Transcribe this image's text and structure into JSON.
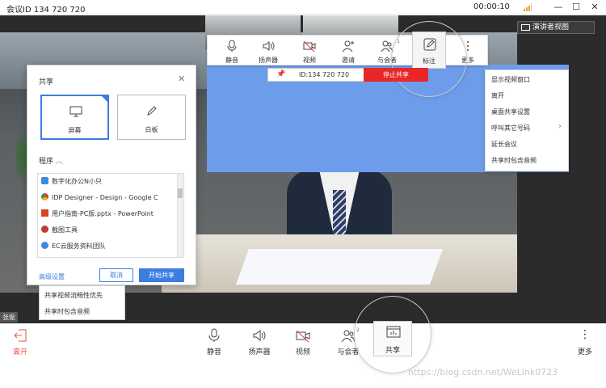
{
  "titlebar": {
    "title": "会议ID 134 720 720",
    "timer": "00:00:10",
    "min_icon": "—",
    "max_icon": "☐",
    "close_icon": "✕"
  },
  "presenter": {
    "speaker_view_label": "演讲者视图"
  },
  "top_toolbar": {
    "items": [
      {
        "label": "静音",
        "icon": "microphone-icon"
      },
      {
        "label": "扬声器",
        "icon": "speaker-icon"
      },
      {
        "label": "视频",
        "icon": "video-off-icon"
      },
      {
        "label": "邀请",
        "icon": "add-user-icon"
      },
      {
        "label": "与会者",
        "icon": "participants-icon",
        "badge": "1"
      },
      {
        "label": "标注",
        "icon": "pencil-icon"
      },
      {
        "label": "更多",
        "icon": "more-icon"
      }
    ]
  },
  "meeting_bar": {
    "id_text": "ID:134 720 720",
    "stop_label": "停止共享"
  },
  "more_menu": {
    "items": [
      {
        "label": "显示视频窗口"
      },
      {
        "label": "离开"
      },
      {
        "label": "桌面共享设置"
      },
      {
        "label": "呼叫其它号码",
        "arrow": "›"
      },
      {
        "label": "延长会议"
      },
      {
        "label": "共享时包含音频"
      }
    ]
  },
  "share_dialog": {
    "title": "共享",
    "close": "✕",
    "options": [
      {
        "label": "屏幕"
      },
      {
        "label": "白板"
      }
    ],
    "programs_header": "程序",
    "programs_caret": "︿",
    "programs": [
      {
        "label": "数字化办公N小只",
        "color": "#3a8be0"
      },
      {
        "label": "IDP Designer - Design - Google C",
        "color": "#e0b52a"
      },
      {
        "label": "用户指南-PC版.pptx - PowerPoint",
        "color": "#d24726"
      },
      {
        "label": "截图工具",
        "color": "#c23a3a"
      },
      {
        "label": "EC云服务资料团队",
        "color": "#3a8be0"
      }
    ],
    "advanced": "高级设置",
    "cancel": "取消",
    "start": "开始共享"
  },
  "advanced_menu": {
    "items": [
      {
        "label": "共享视频流畅性优先"
      },
      {
        "label": "共享时包含音频"
      }
    ]
  },
  "participant_name": "张振",
  "bottom_bar": {
    "leave": "离开",
    "items": [
      {
        "label": "静音",
        "icon": "microphone-icon"
      },
      {
        "label": "扬声器",
        "icon": "speaker-icon"
      },
      {
        "label": "视频",
        "icon": "video-off-icon"
      },
      {
        "label": "与会者",
        "icon": "participants-icon",
        "badge": "2"
      },
      {
        "label": "共享",
        "icon": "share-icon"
      }
    ],
    "more": "更多",
    "more_glyph": "⋮"
  },
  "watermark": "https://blog.csdn.net/WeLink0723",
  "colors": {
    "accent": "#3b7de0",
    "stop": "#e82727",
    "leave": "#e85540",
    "share_bg": "#6d9ceb"
  }
}
